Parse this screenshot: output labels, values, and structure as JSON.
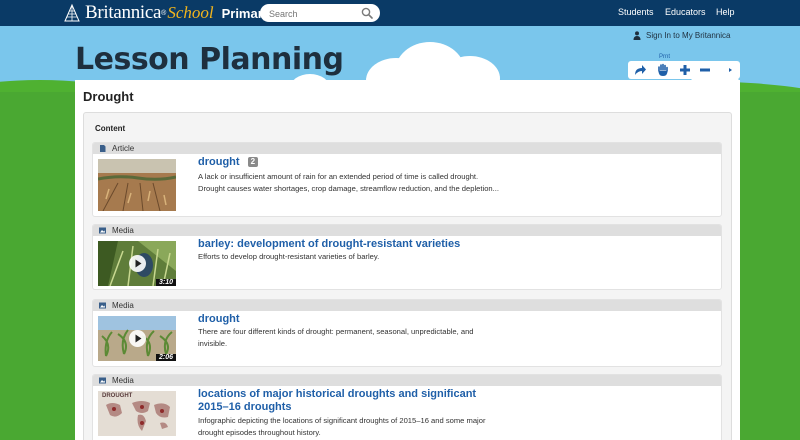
{
  "header": {
    "logo": {
      "brand": "Britannica",
      "tm": "®",
      "school": "School",
      "level": "Primary"
    },
    "search": {
      "placeholder": "Search",
      "value": ""
    },
    "nav": [
      "Students",
      "Educators",
      "Help"
    ],
    "signin": "Sign In to My Britannica"
  },
  "hero": {
    "title": "Lesson Planning"
  },
  "toolbar": {
    "label": "Prnt",
    "buttons": [
      "share-icon",
      "hand-icon",
      "zoom-in-icon",
      "zoom-out-icon",
      "expand-arrow-icon"
    ]
  },
  "main": {
    "title": "Drought",
    "content_label": "Content",
    "items": [
      {
        "type": "Article",
        "title": "drought",
        "badge": "2",
        "description": "A lack or insufficient amount of rain for an extended period of time is called drought. Drought causes water shortages, crop damage, streamflow reduction, and the depletion...",
        "duration": ""
      },
      {
        "type": "Media",
        "title": "barley: development of drought-resistant varieties",
        "description": "Efforts to develop drought-resistant varieties of barley.",
        "duration": "3:10"
      },
      {
        "type": "Media",
        "title": "drought",
        "description": "There are four different kinds of drought: permanent, seasonal, unpredictable, and invisible.",
        "duration": "2:06"
      },
      {
        "type": "Media",
        "title": "locations of major historical droughts and significant 2015–16 droughts",
        "description": "Infographic depicting the locations of significant droughts of 2015–16 and some major drought episodes throughout history.",
        "thumb_text": "DROUGHT",
        "duration": ""
      }
    ]
  },
  "colors": {
    "topbar": "#0a3a66",
    "sky": "#7ac6ec",
    "grass": "#4aa832",
    "link": "#1f5fa8",
    "school_accent": "#f2b51d"
  }
}
